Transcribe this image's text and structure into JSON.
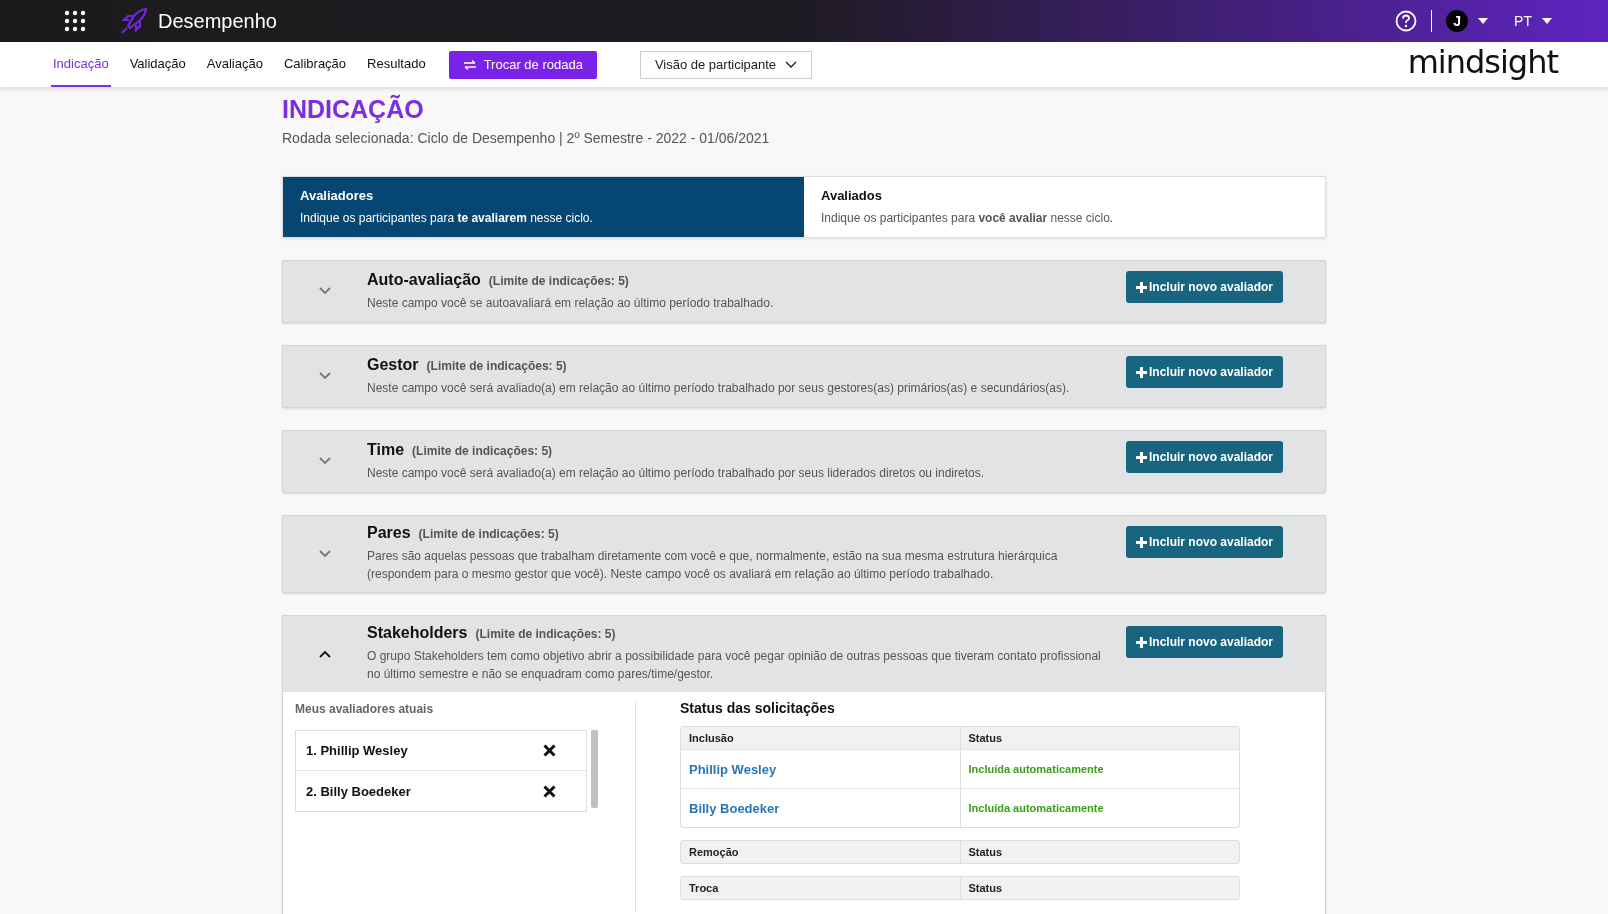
{
  "app": {
    "title": "Desempenho"
  },
  "header": {
    "user_initial": "J",
    "language": "PT",
    "brand": "mindsight"
  },
  "nav": {
    "tabs": [
      {
        "label": "Indicação",
        "selected": true
      },
      {
        "label": "Validação",
        "selected": false
      },
      {
        "label": "Avaliação",
        "selected": false
      },
      {
        "label": "Calibração",
        "selected": false
      },
      {
        "label": "Resultado",
        "selected": false
      }
    ],
    "switch_button": "Trocar de rodada",
    "view_select": "Visão de participante"
  },
  "page": {
    "title": "INDICAÇÃO",
    "subtitle": "Rodada selecionada: Ciclo de Desempenho | 2º Semestre - 2022 - 01/06/2021"
  },
  "role_tabs": [
    {
      "title": "Avaliadores",
      "description": "Indique os participantes para **te avaliarem** nesse ciclo.",
      "selected": true
    },
    {
      "title": "Avaliados",
      "description": "Indique os participantes para **você avaliar** nesse ciclo.",
      "selected": false
    }
  ],
  "sections": [
    {
      "title": "Auto-avaliação",
      "limit": "(Limite de indicações: 5)",
      "description": "Neste campo você se autoavaliará em relação ao último período trabalhado.",
      "button": "Incluir novo avaliador",
      "expanded": false
    },
    {
      "title": "Gestor",
      "limit": "(Limite de indicações: 5)",
      "description": "Neste campo você será avaliado(a) em relação ao último período trabalhado por seus gestores(as) primários(as) e secundários(as).",
      "button": "Incluir novo avaliador",
      "expanded": false
    },
    {
      "title": "Time",
      "limit": "(Limite de indicações: 5)",
      "description": "Neste campo você será avaliado(a) em relação ao último período trabalhado por seus liderados diretos ou indiretos.",
      "button": "Incluir novo avaliador",
      "expanded": false
    },
    {
      "title": "Pares",
      "limit": "(Limite de indicações: 5)",
      "description": "Pares são aquelas pessoas que trabalham diretamente com você e que, normalmente, estão na sua mesma estrutura hierárquica (respondem para o mesmo gestor que você). Neste campo você os avaliará em relação ao último período trabalhado.",
      "button": "Incluir novo avaliador",
      "expanded": false
    },
    {
      "title": "Stakeholders",
      "limit": "(Limite de indicações: 5)",
      "description": "O grupo Stakeholders tem como objetivo abrir a possibilidade para você pegar opinião de outras pessoas que tiveram contato profissional no último semestre e não se enquadram como pares/time/gestor.",
      "button": "Incluir novo avaliador",
      "expanded": true,
      "details": {
        "current_title": "Meus avaliadores atuais",
        "current_items": [
          "1. Phillip Wesley",
          "2. Billy Boedeker"
        ],
        "status_title": "Status das solicitações",
        "tables": [
          {
            "columns": [
              "Inclusão",
              "Status"
            ],
            "rows": [
              {
                "name": "Phillip Wesley",
                "status": "Incluída automaticamente"
              },
              {
                "name": "Billy Boedeker",
                "status": "Incluída automaticamente"
              }
            ]
          },
          {
            "columns": [
              "Remoção",
              "Status"
            ]
          },
          {
            "columns": [
              "Troca",
              "Status"
            ]
          }
        ]
      }
    }
  ]
}
